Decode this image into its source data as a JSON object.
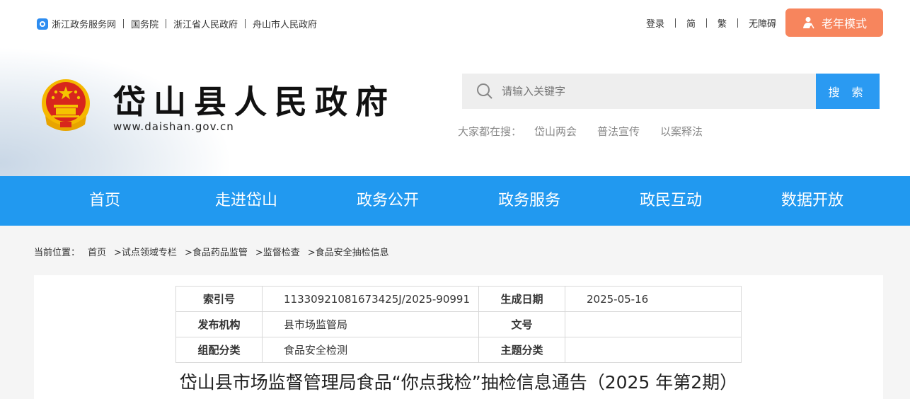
{
  "top_links": [
    "浙江政务服务网",
    "国务院",
    "浙江省人民政府",
    "舟山市人民政府"
  ],
  "top_right": [
    "登录",
    "简",
    "繁",
    "无障碍"
  ],
  "elder_mode_label": "老年模式",
  "site": {
    "name": "岱山县人民政府",
    "url": "www.daishan.gov.cn"
  },
  "search": {
    "placeholder": "请输入关键字",
    "button_label": "搜 索",
    "hot_label": "大家都在搜：",
    "hot_items": [
      "岱山两会",
      "普法宣传",
      "以案释法"
    ]
  },
  "nav": [
    "首页",
    "走进岱山",
    "政务公开",
    "政务服务",
    "政民互动",
    "数据开放"
  ],
  "breadcrumb": [
    "当前位置：",
    "首页",
    ">试点领域专栏",
    ">食品药品监管",
    ">监督检查",
    ">食品安全抽检信息"
  ],
  "meta": {
    "index_key": "索引号",
    "index_val": "11330921081673425J/2025-90991",
    "date_key": "生成日期",
    "date_val": "2025-05-16",
    "publisher_key": "发布机构",
    "publisher_val": "县市场监管局",
    "docno_key": "文号",
    "docno_val": "",
    "category_key": "组配分类",
    "category_val": "食品安全检测",
    "topic_key": "主题分类",
    "topic_val": ""
  },
  "article_title": "岱山县市场监督管理局食品“你点我检”抽检信息通告（2025 年第2期）",
  "colors": {
    "nav_blue": "#2199f0",
    "search_blue": "#2a9af2",
    "elder_orange": "#f7855d"
  }
}
